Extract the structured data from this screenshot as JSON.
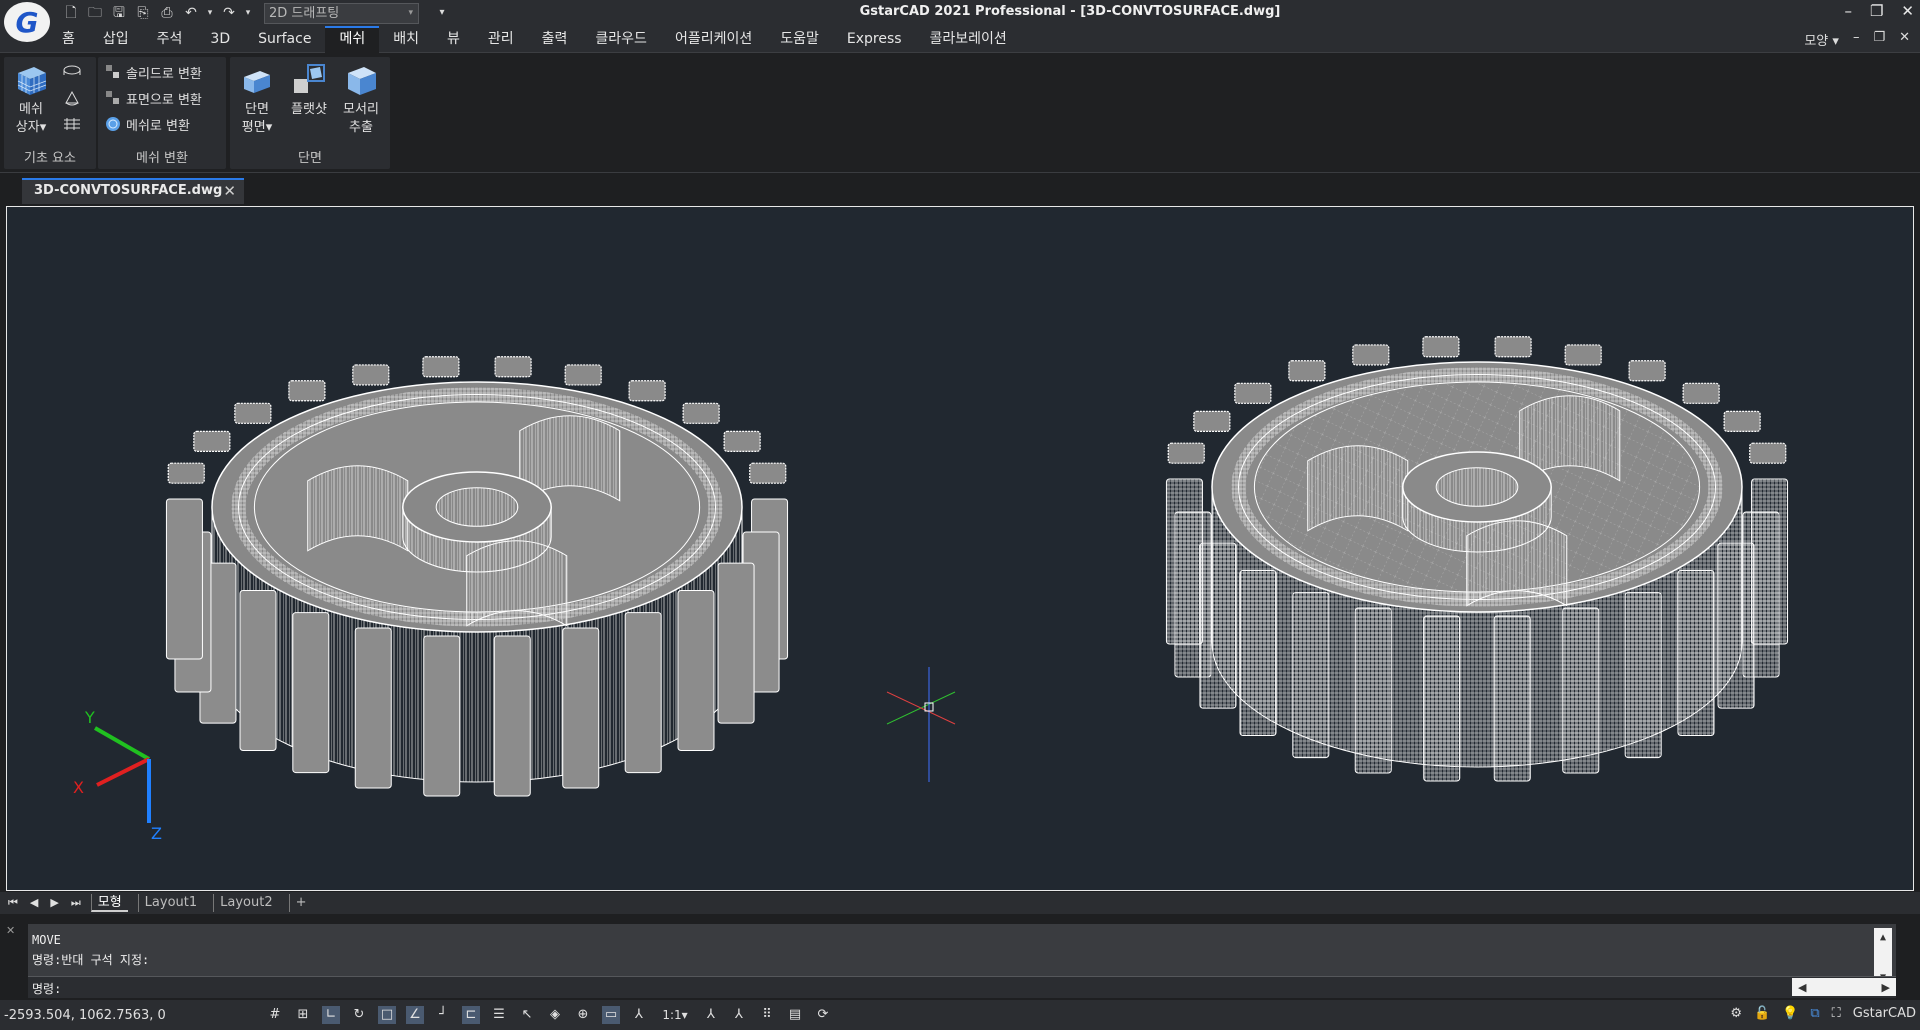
{
  "app": {
    "logo_letter": "G",
    "title": "GstarCAD 2021 Professional - [3D-CONVTOSURFACE.dwg]",
    "workspace": "2D 드래프팅"
  },
  "menu": {
    "items": [
      "홈",
      "삽입",
      "주석",
      "3D",
      "Surface",
      "메쉬",
      "배치",
      "뷰",
      "관리",
      "출력",
      "클라우드",
      "어플리케이션",
      "도움말",
      "Express",
      "콜라보레이션"
    ],
    "active": "메쉬",
    "right_label": "모양"
  },
  "ribbon": {
    "panels": [
      {
        "label": "기초 요소",
        "buttons": [
          {
            "label": "메쉬\n상자"
          }
        ]
      },
      {
        "label": "메쉬 변환",
        "items": [
          "솔리드로 변환",
          "표면으로 변환",
          "메쉬로 변환"
        ]
      },
      {
        "label": "단면",
        "buttons": [
          {
            "label": "단면\n평면"
          },
          {
            "label": "플랫샷"
          },
          {
            "label": "모서리\n추출"
          }
        ]
      }
    ],
    "panel1_label": "기초 요소",
    "panel1_btn_line1": "메쉬",
    "panel1_btn_line2": "상자",
    "panel2_label": "메쉬 변환",
    "panel2_item1": "솔리드로 변환",
    "panel2_item2": "표면으로 변환",
    "panel2_item3": "메쉬로 변환",
    "panel3_label": "단면",
    "panel3_btn1_line1": "단면",
    "panel3_btn1_line2": "평면",
    "panel3_btn2": "플랫샷",
    "panel3_btn3_line1": "모서리",
    "panel3_btn3_line2": "추출"
  },
  "document": {
    "tab_name": "3D-CONVTOSURFACE.dwg"
  },
  "ucs": {
    "x": "X",
    "y": "Y",
    "z": "Z"
  },
  "layouts": {
    "tabs": [
      "모형",
      "Layout1",
      "Layout2",
      "+"
    ],
    "active": "모형"
  },
  "command": {
    "history": [
      "MOVE",
      "명령:반대 구석 지정:"
    ],
    "prompt": "명령:"
  },
  "status": {
    "coords": "-2593.504, 1062.7563, 0",
    "scale": "1:1",
    "app_label": "GstarCAD"
  },
  "colors": {
    "accent": "#2a7ae8",
    "viewport_bg": "#212830",
    "ucs_x": "#e02020",
    "ucs_y": "#20c020",
    "ucs_z": "#2080ff"
  }
}
